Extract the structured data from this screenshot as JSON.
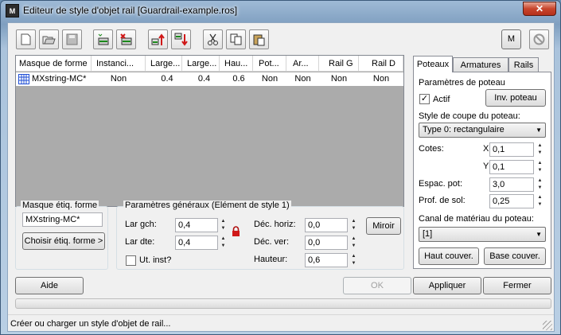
{
  "window": {
    "title": "Editeur de style d'objet rail [Guardrail-example.ros]",
    "app_icon_text": "M",
    "close_label": "✕"
  },
  "toolbar": {
    "buttons": [
      "new-icon",
      "open-icon",
      "save-icon",
      "load-shape-icon",
      "delete-shape-icon",
      "move-up-icon",
      "move-down-icon",
      "cut-icon",
      "copy-icon",
      "paste-icon"
    ],
    "m_label": "M",
    "settings_icon": "settings-disabled-icon"
  },
  "grid": {
    "columns": [
      "Masque de forme",
      "Instanci...",
      "Large...",
      "Large...",
      "Hau...",
      "Pot...",
      "Ar...",
      "Rail G",
      "Rail D"
    ],
    "rows": [
      {
        "name": "MXstring-MC*",
        "icon": "spline-grid-icon",
        "cells": [
          "Non",
          "0.4",
          "0.4",
          "0.6",
          "Non",
          "Non",
          "Non",
          "Non"
        ]
      }
    ]
  },
  "mask_label": {
    "title": "Masque étiq. forme",
    "value": "MXstring-MC*",
    "choose_label": "Choisir étiq. forme >"
  },
  "general": {
    "title": "Paramètres généraux (Elément de style 1)",
    "lar_gch_label": "Lar gch:",
    "lar_gch_value": "0,4",
    "lar_dte_label": "Lar dte:",
    "lar_dte_value": "0,4",
    "lock_icon": "lock-icon",
    "ut_inst_label": "Ut. inst?",
    "ut_inst_checked": false,
    "dec_horiz_label": "Déc. horiz:",
    "dec_horiz_value": "0,0",
    "dec_ver_label": "Déc. ver:",
    "dec_ver_value": "0,0",
    "hauteur_label": "Hauteur:",
    "hauteur_value": "0,6",
    "miroir_label": "Miroir"
  },
  "tabs": [
    "Poteaux",
    "Armatures",
    "Rails"
  ],
  "active_tab": "Poteaux",
  "posts": {
    "params_label": "Paramètres de poteau",
    "actif_label": "Actif",
    "actif_checked": true,
    "inv_label": "Inv. poteau",
    "coupe_label": "Style de coupe du poteau:",
    "coupe_value": "Type 0: rectangulaire",
    "cotes_label": "Cotes:",
    "x_label": "X",
    "x_value": "0,1",
    "y_label": "Y",
    "y_value": "0,1",
    "espac_label": "Espac. pot:",
    "espac_value": "3,0",
    "prof_label": "Prof. de sol:",
    "prof_value": "0,25",
    "canal_label": "Canal de matériau du poteau:",
    "canal_value": "[1]",
    "haut_label": "Haut couver.",
    "base_label": "Base couver."
  },
  "footer": {
    "aide_label": "Aide",
    "ok_label": "OK",
    "appliquer_label": "Appliquer",
    "fermer_label": "Fermer"
  },
  "status": {
    "text": "Créer ou charger un style d'objet de rail..."
  },
  "colors": {
    "accent_red": "#d01818",
    "selection": "#3399ff"
  }
}
